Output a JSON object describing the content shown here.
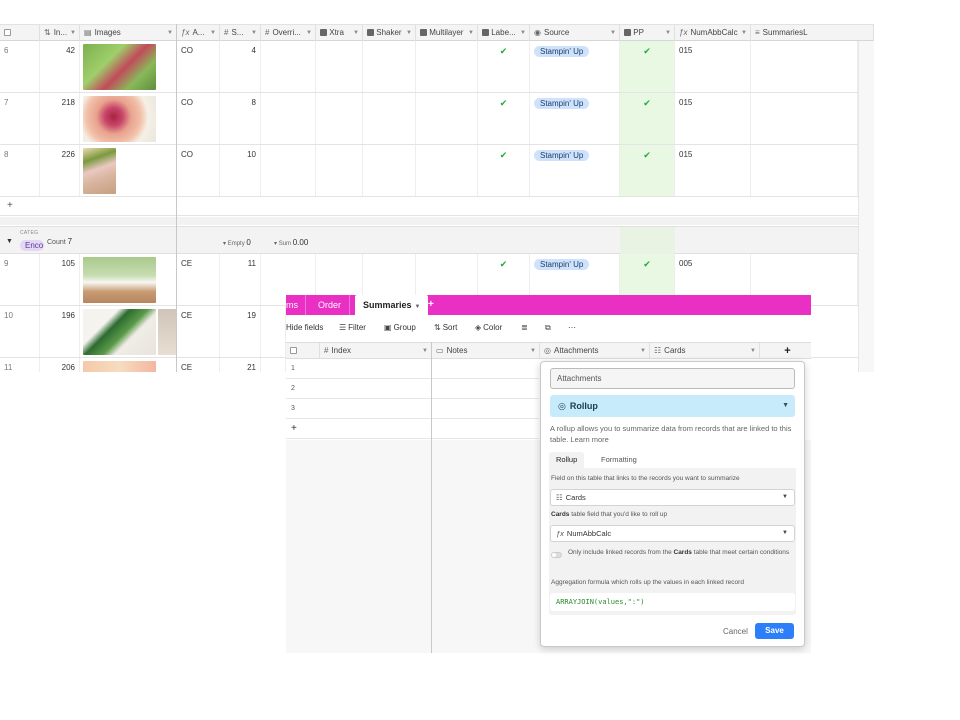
{
  "grid": {
    "columns": {
      "index": "In...",
      "images": "Images",
      "a": "A...",
      "s": "S...",
      "override": "Overri...",
      "xtra": "Xtra",
      "shaker": "Shaker",
      "multilayer": "Multilayer",
      "label": "Labe...",
      "source": "Source",
      "pp": "PP",
      "numabb": "NumAbbCalc",
      "summaries": "SummariesL"
    },
    "rows": [
      {
        "num": "6",
        "index": "42",
        "a": "CO",
        "s": "4",
        "label": "✔",
        "source": "Stampin' Up",
        "pp": "✔",
        "numabb": "015"
      },
      {
        "num": "7",
        "index": "218",
        "a": "CO",
        "s": "8",
        "label": "✔",
        "source": "Stampin' Up",
        "pp": "✔",
        "numabb": "015"
      },
      {
        "num": "8",
        "index": "226",
        "a": "CO",
        "s": "10",
        "label": "✔",
        "source": "Stampin' Up",
        "pp": "✔",
        "numabb": "015"
      },
      {
        "num": "9",
        "index": "105",
        "a": "CE",
        "s": "11",
        "label": "✔",
        "source": "Stampin' Up",
        "pp": "✔",
        "numabb": "005"
      },
      {
        "num": "10",
        "index": "196",
        "a": "CE",
        "s": "19"
      },
      {
        "num": "11",
        "index": "206",
        "a": "CE",
        "s": "21"
      }
    ],
    "add_row": "+",
    "group": {
      "label": "CATEG",
      "value": "Enco",
      "count_label": "Count",
      "count": "7",
      "empty_label": "Empty",
      "empty_value": "0",
      "sum_label": "Sum",
      "sum_value": "0.00"
    }
  },
  "overlay": {
    "tabs": {
      "t1": "ms",
      "t2": "Order",
      "t3": "Summaries",
      "add": "+"
    },
    "toolbar": {
      "hide": "Hide fields",
      "filter": "Filter",
      "group": "Group",
      "sort": "Sort",
      "color": "Color"
    },
    "columns": {
      "index": "Index",
      "notes": "Notes",
      "attachments": "Attachments",
      "cards": "Cards",
      "add": "+"
    },
    "rows": [
      "1",
      "2",
      "3"
    ],
    "add_row": "+"
  },
  "popup": {
    "name_value": "Attachments",
    "type": "Rollup",
    "description": "A rollup allows you to summarize data from records that are linked to this table. Learn more",
    "tab_rollup": "Rollup",
    "tab_formatting": "Formatting",
    "field_label": "Field on this table that links to the records you want to summarize",
    "field_value": "Cards",
    "rollup_label_bold": "Cards",
    "rollup_label_rest": " table field that you'd like to roll up",
    "rollup_value": "NumAbbCalc",
    "toggle_text_a": "Only include linked records from the ",
    "toggle_text_bold": "Cards",
    "toggle_text_b": " table that meet certain conditions",
    "aggregation_label": "Aggregation formula which rolls up the values in each linked record",
    "formula": "ARRAYJOIN(values,\":\")",
    "cancel": "Cancel",
    "save": "Save"
  },
  "colors": {
    "accent": "#e92fc4",
    "save": "#2d7ff9",
    "pill": "#cfe2fb",
    "pp": "#e9f8e2",
    "rollup": "#c7ebfb",
    "tick": "#1eaa3c"
  },
  "icons": {
    "formula": "formula-icon",
    "number": "hash-icon",
    "checkbox": "checkbox-icon",
    "select": "single-select-icon",
    "link": "link-icon",
    "attachment": "attachment-icon",
    "rollup": "rollup-icon"
  }
}
